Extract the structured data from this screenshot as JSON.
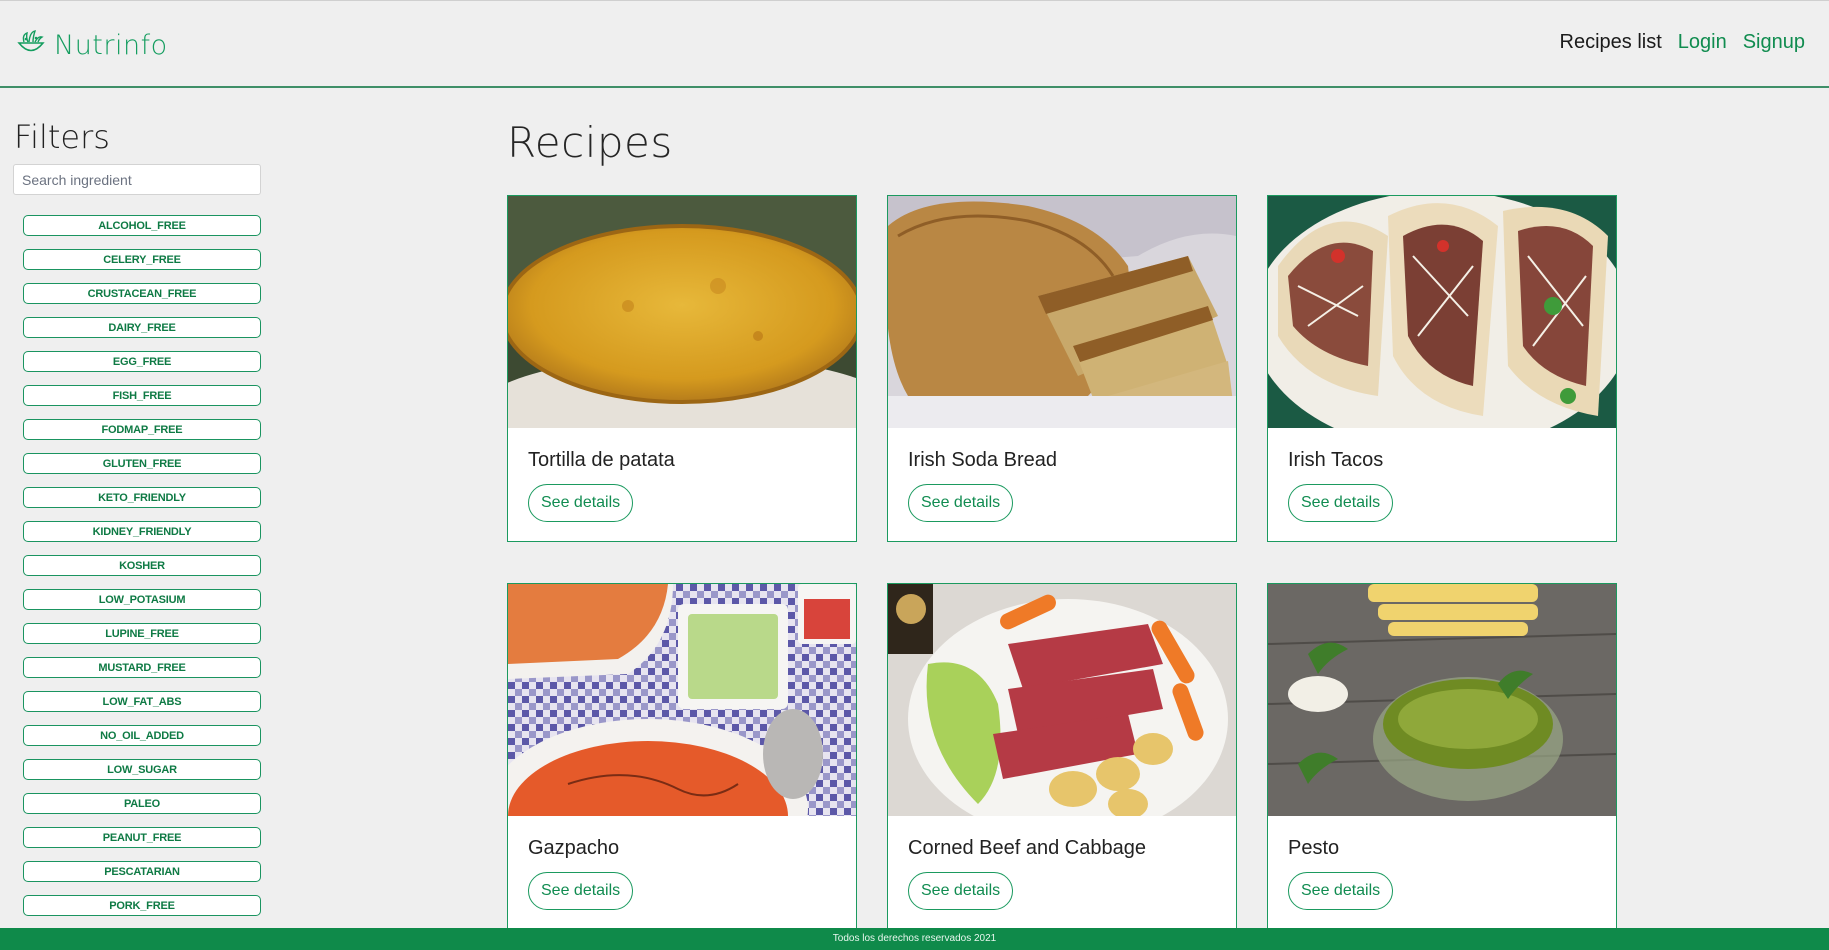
{
  "brand": {
    "name": "Nutrinfo",
    "logo_icon": "salad-bowl-icon",
    "accent_color": "#149d5f"
  },
  "nav": {
    "recipes_list": "Recipes list",
    "login": "Login",
    "signup": "Signup"
  },
  "sidebar": {
    "title": "Filters",
    "search_placeholder": "Search ingredient",
    "filters": [
      "ALCOHOL_FREE",
      "CELERY_FREE",
      "CRUSTACEAN_FREE",
      "DAIRY_FREE",
      "EGG_FREE",
      "FISH_FREE",
      "FODMAP_FREE",
      "GLUTEN_FREE",
      "KETO_FRIENDLY",
      "KIDNEY_FRIENDLY",
      "KOSHER",
      "LOW_POTASIUM",
      "LUPINE_FREE",
      "MUSTARD_FREE",
      "LOW_FAT_ABS",
      "NO_OIL_ADDED",
      "LOW_SUGAR",
      "PALEO",
      "PEANUT_FREE",
      "PESCATARIAN",
      "PORK_FREE"
    ]
  },
  "main": {
    "title": "Recipes",
    "button_label": "See details",
    "recipes": [
      {
        "title": "Tortilla de patata",
        "image": "spanish-omelette-photo"
      },
      {
        "title": "Irish Soda Bread",
        "image": "sliced-bread-loaf-photo"
      },
      {
        "title": "Irish Tacos",
        "image": "tacos-with-slaw-photo"
      },
      {
        "title": "Gazpacho",
        "image": "gazpacho-bowl-photo"
      },
      {
        "title": "Corned Beef and Cabbage",
        "image": "corned-beef-plate-photo"
      },
      {
        "title": "Pesto",
        "image": "pesto-bowl-photo"
      }
    ]
  },
  "footer": {
    "text": "Todos los derechos reservados 2021"
  },
  "colors": {
    "primary_green": "#0f8a4a",
    "background": "#efefef"
  }
}
